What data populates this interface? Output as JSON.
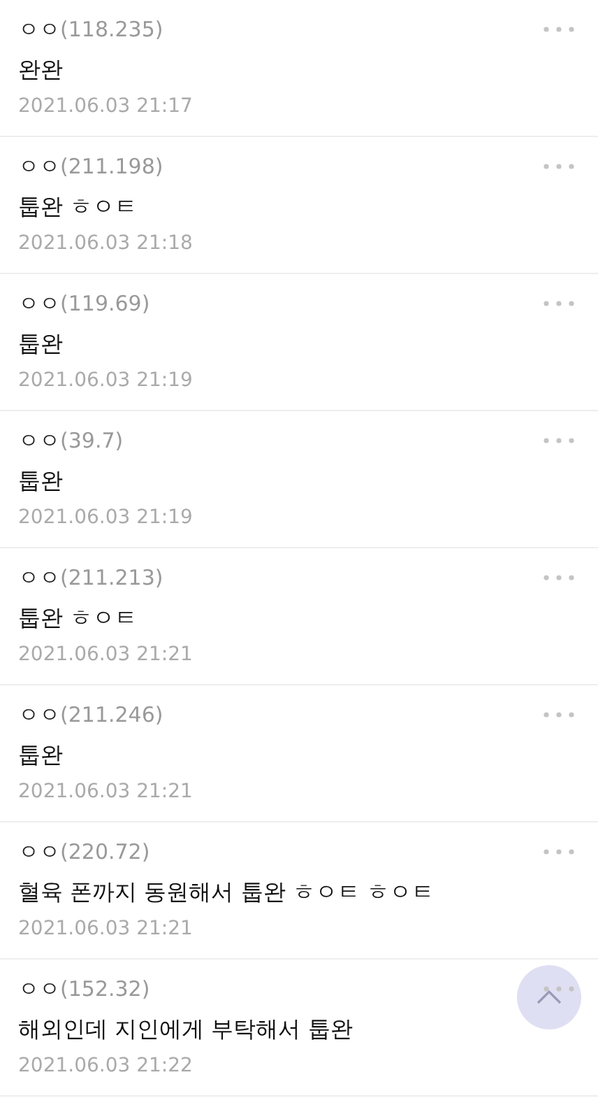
{
  "comments": [
    {
      "author": "ㅇㅇ",
      "ip": "(118.235)",
      "text": "완완",
      "date": "2021.06.03 21:17"
    },
    {
      "author": "ㅇㅇ",
      "ip": "(211.198)",
      "text": "툽완 ㅎㅇㅌ",
      "date": "2021.06.03 21:18"
    },
    {
      "author": "ㅇㅇ",
      "ip": "(119.69)",
      "text": "툽완",
      "date": "2021.06.03 21:19"
    },
    {
      "author": "ㅇㅇ",
      "ip": "(39.7)",
      "text": "툽완",
      "date": "2021.06.03 21:19"
    },
    {
      "author": "ㅇㅇ",
      "ip": "(211.213)",
      "text": "툽완 ㅎㅇㅌ",
      "date": "2021.06.03 21:21"
    },
    {
      "author": "ㅇㅇ",
      "ip": "(211.246)",
      "text": "툽완",
      "date": "2021.06.03 21:21"
    },
    {
      "author": "ㅇㅇ",
      "ip": "(220.72)",
      "text": "혈육 폰까지 동원해서 툽완 ㅎㅇㅌ ㅎㅇㅌ",
      "date": "2021.06.03 21:21"
    },
    {
      "author": "ㅇㅇ",
      "ip": "(152.32)",
      "text": "해외인데 지인에게 부탁해서 툽완",
      "date": "2021.06.03 21:22"
    }
  ]
}
